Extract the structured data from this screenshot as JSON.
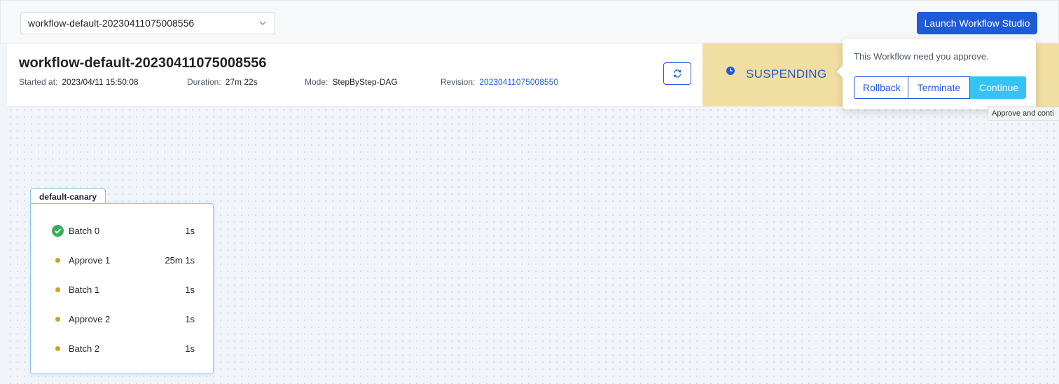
{
  "topbar": {
    "workflow_select": "workflow-default-20230411075008556",
    "launch_label": "Launch Workflow Studio"
  },
  "info": {
    "title": "workflow-default-20230411075008556",
    "started_label": "Started at:",
    "started_value": "2023/04/11 15:50:08",
    "duration_label": "Duration:",
    "duration_value": "27m 22s",
    "mode_label": "Mode:",
    "mode_value": "StepByStep-DAG",
    "revision_label": "Revision:",
    "revision_value": "20230411075008550",
    "refresh_icon": "refresh-icon"
  },
  "status": {
    "icon": "clock-icon",
    "text": "SUSPENDING",
    "background": "#f1dea2",
    "color": "#1f5ad9"
  },
  "popover": {
    "message": "This Workflow need you approve.",
    "rollback_label": "Rollback",
    "terminate_label": "Terminate",
    "continue_label": "Continue",
    "continue_color": "#33c3f5"
  },
  "tooltip": {
    "text": "Approve and conti"
  },
  "group": {
    "name": "default-canary",
    "steps": [
      {
        "name": "Batch 0",
        "duration": "1s",
        "status": "succeeded",
        "status_icon": "check-circle-icon",
        "color": "#3aad5a"
      },
      {
        "name": "Approve 1",
        "duration": "25m 1s",
        "status": "pending",
        "status_icon": "dot-icon",
        "color": "#c9a227"
      },
      {
        "name": "Batch 1",
        "duration": "1s",
        "status": "pending",
        "status_icon": "dot-icon",
        "color": "#c9a227"
      },
      {
        "name": "Approve 2",
        "duration": "1s",
        "status": "pending",
        "status_icon": "dot-icon",
        "color": "#c9a227"
      },
      {
        "name": "Batch 2",
        "duration": "1s",
        "status": "pending",
        "status_icon": "dot-icon",
        "color": "#c9a227"
      }
    ]
  }
}
